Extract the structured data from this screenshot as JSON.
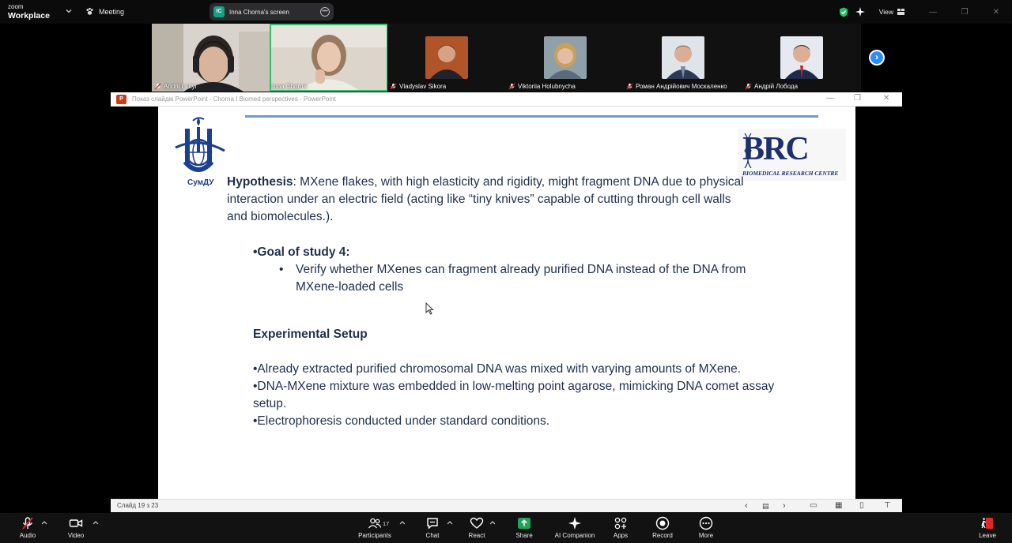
{
  "app": {
    "logo_top": "zoom",
    "logo_bottom": "Workplace",
    "meeting_label": "Meeting"
  },
  "share": {
    "badge": "IC",
    "label": "Inna Chorna's screen"
  },
  "top_right": {
    "view_label": "View"
  },
  "participants": [
    {
      "name": "Andrii Liutyi",
      "muted": true
    },
    {
      "name": "Inna Chorna",
      "muted": false,
      "active": true
    },
    {
      "name": "Vladyslav Sikora",
      "muted": true
    },
    {
      "name": "Viktoriia Holubnycha",
      "muted": true
    },
    {
      "name": "Роман Андрійович Москаленко",
      "muted": true
    },
    {
      "name": "Андрій Лобода",
      "muted": true
    }
  ],
  "ppt": {
    "icon_letter": "P",
    "title": "Показ слайдів PowerPoint  -  Chorna I Biomed perspectives - PowerPoint",
    "status": "Слайд 19 з 23"
  },
  "slide": {
    "logo_left_caption": "СумДУ",
    "logo_right_big": "BRC",
    "logo_right_small": "BIOMEDICAL RESEARCH CENTRE",
    "hypothesis_label": "Hypothesis",
    "hypothesis_text": ": MXene flakes, with high elasticity and rigidity, might fragment DNA due to physical interaction under an electric field (acting like “tiny knives” capable of cutting through cell walls and biomolecules.).",
    "goal_title": "•Goal of study 4:",
    "bullet": "•",
    "goal_item": "Verify whether MXenes can fragment already purified DNA instead of the DNA from MXene-loaded cells",
    "exp_title": "Experimental Setup",
    "exp_items": [
      "•Already extracted purified chromosomal DNA was mixed with varying amounts of MXene.",
      "•DNA-MXene mixture was embedded in low-melting point agarose, mimicking DNA comet assay setup.",
      "•Electrophoresis conducted under standard conditions."
    ]
  },
  "toolbar": {
    "audio": "Audio",
    "video": "Video",
    "participants": "Participants",
    "participants_count": "17",
    "chat": "Chat",
    "react": "React",
    "share": "Share",
    "ai": "AI Companion",
    "apps": "Apps",
    "record": "Record",
    "more": "More",
    "leave": "Leave"
  },
  "colors": {
    "accent_blue": "#2d8cff",
    "share_green": "#1ea55a",
    "leave_red": "#e02828",
    "slide_text": "#1f2f4f",
    "slide_rule": "#6c9bd2"
  }
}
